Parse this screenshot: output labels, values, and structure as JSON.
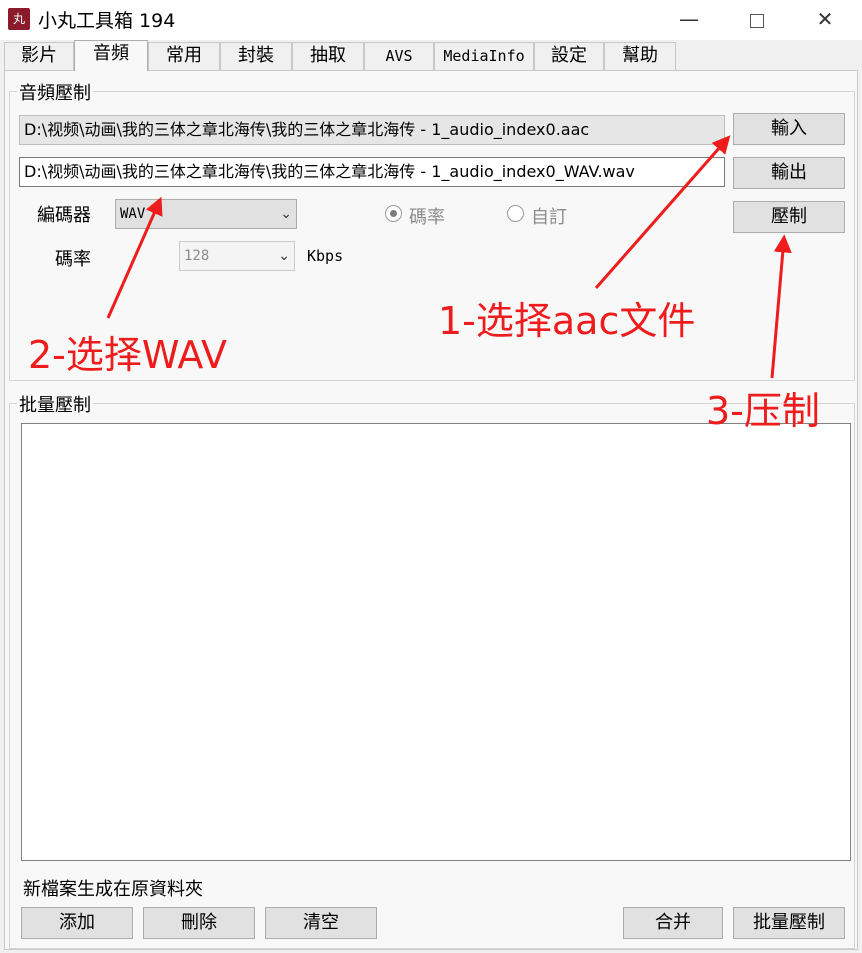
{
  "window": {
    "title": "小丸工具箱 194",
    "app_icon_text": "丸",
    "minimize_label": "—",
    "close_label": "✕"
  },
  "tabs": [
    {
      "label": "影片",
      "active": false
    },
    {
      "label": "音頻",
      "active": true
    },
    {
      "label": "常用",
      "active": false
    },
    {
      "label": "封裝",
      "active": false
    },
    {
      "label": "抽取",
      "active": false
    },
    {
      "label": "AVS",
      "active": false
    },
    {
      "label": "MediaInfo",
      "active": false
    },
    {
      "label": "設定",
      "active": false
    },
    {
      "label": "幫助",
      "active": false
    }
  ],
  "audio_encode": {
    "group_label": "音頻壓制",
    "input_path": "D:\\视频\\动画\\我的三体之章北海传\\我的三体之章北海传 - 1_audio_index0.aac",
    "output_path": "D:\\视频\\动画\\我的三体之章北海传\\我的三体之章北海传 - 1_audio_index0_WAV.wav",
    "input_button": "輸入",
    "output_button": "輸出",
    "encode_button": "壓制",
    "encoder_label": "編碼器",
    "encoder_value": "WAV",
    "bitrate_label": "碼率",
    "bitrate_value": "128",
    "bitrate_unit": "Kbps",
    "radio_bitrate": "碼率",
    "radio_custom": "自訂"
  },
  "batch_encode": {
    "group_label": "批量壓制",
    "note": "新檔案生成在原資料夾",
    "add_button": "添加",
    "delete_button": "刪除",
    "clear_button": "清空",
    "merge_button": "合并",
    "batch_button": "批量壓制"
  },
  "annotations": {
    "step1": "1-选择aac文件",
    "step2": "2-选择WAV",
    "step3": "3-压制",
    "color": "#ee1c1c"
  },
  "icons": {
    "dropdown": "chevron-down-icon",
    "maximize": "maximize-icon"
  }
}
